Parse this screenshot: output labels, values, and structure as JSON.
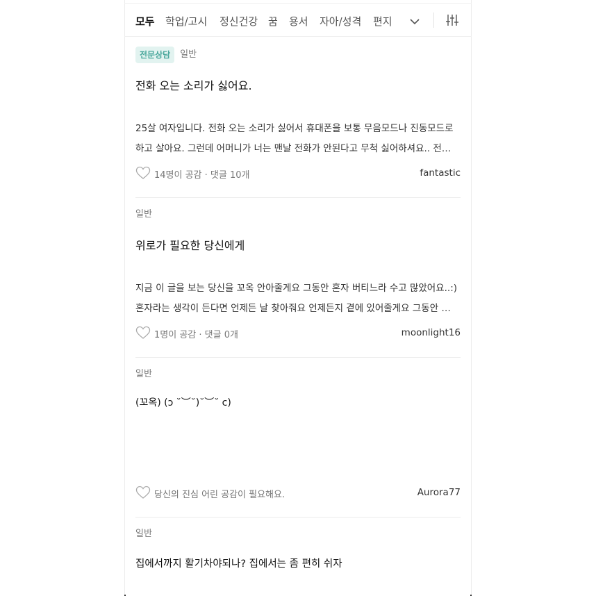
{
  "tabs": {
    "items": [
      "모두",
      "학업/고시",
      "정신건강",
      "꿈",
      "용서",
      "자아/성격",
      "편지"
    ],
    "active_index": 0
  },
  "icons": {
    "expand": "chevron-down-icon",
    "filter": "sliders-icon",
    "like": "heart-outline-icon"
  },
  "colors": {
    "expert_badge_text": "#4aa79c",
    "expert_badge_bg": "#e2f3f0",
    "divider": "#ececec"
  },
  "posts": [
    {
      "expert_badge": "전문상담",
      "category": "일반",
      "title": "전화 오는 소리가 싫어요.",
      "body_lines": [
        "25살 여자입니다. 전화 오는 소리가 싫어서 휴대폰을 보통 무음모드나 진동모드로",
        "하고 살아요. 그런데 어머니가 너는 맨날 전화가 안된다고 무척 싫어하셔요.. 전…"
      ],
      "meta": "14명이 공감 · 댓글 10개",
      "author": "fantastic"
    },
    {
      "category": "일반",
      "title": "위로가 필요한 당신에게",
      "body_lines": [
        "지금 이 글을 보는 당신을 꼬옥 안아줄게요 그동안 혼자 버티느라 수고 많았어요..:)",
        "혼자라는 생각이 든다면 언제든 날 찾아줘요 언제든지 곁에 있어줄게요 그동안 …"
      ],
      "meta": "1명이 공감 · 댓글 0개",
      "author": "moonlight16"
    },
    {
      "category": "일반",
      "title": "(꼬옥) (ↄ ˘︶˘)˘︶˘ c)",
      "body_lines": [],
      "meta": "당신의 진심 어린 공감이 필요해요.",
      "author": "Aurora77"
    },
    {
      "category": "일반",
      "title": "집에서까지 활기차야되나? 집에서는 좀 편히 쉬자",
      "body_lines": [],
      "meta": "",
      "author": ""
    }
  ]
}
